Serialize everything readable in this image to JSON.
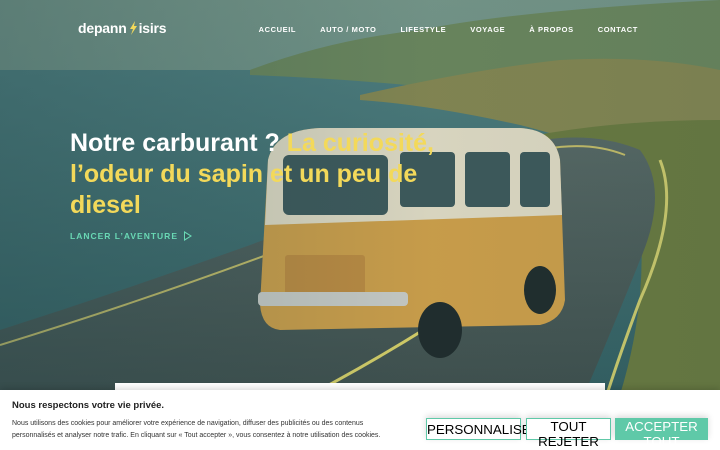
{
  "header": {
    "logo_left": "depann",
    "logo_right": "isirs",
    "nav": [
      "ACCUEIL",
      "AUTO / MOTO",
      "LIFESTYLE",
      "VOYAGE",
      "À PROPOS",
      "CONTACT"
    ]
  },
  "hero": {
    "headline_white": "Notre carburant ? ",
    "headline_accent": "La curiosité, l’odeur du sapin et un peu de diesel",
    "cta_label": "LANCER L’AVENTURE"
  },
  "cookie": {
    "title": "Nous respectons votre vie privée.",
    "text": "Nous utilisons des cookies pour améliorer votre expérience de navigation, diffuser des publicités ou des contenus personnalisés et analyser notre trafic. En cliquant sur « Tout accepter », vous consentez à notre utilisation des cookies.",
    "personalise_label": "PERSONNALISER",
    "reject_label": "TOUT REJETER",
    "accept_label": "ACCEPTER TOUT"
  },
  "colors": {
    "accent_yellow": "#f3d95a",
    "accent_green": "#5fc9a8",
    "overlay_teal": "#2c4a4a"
  },
  "icons": [
    "logo-bolt-icon",
    "play-icon"
  ]
}
